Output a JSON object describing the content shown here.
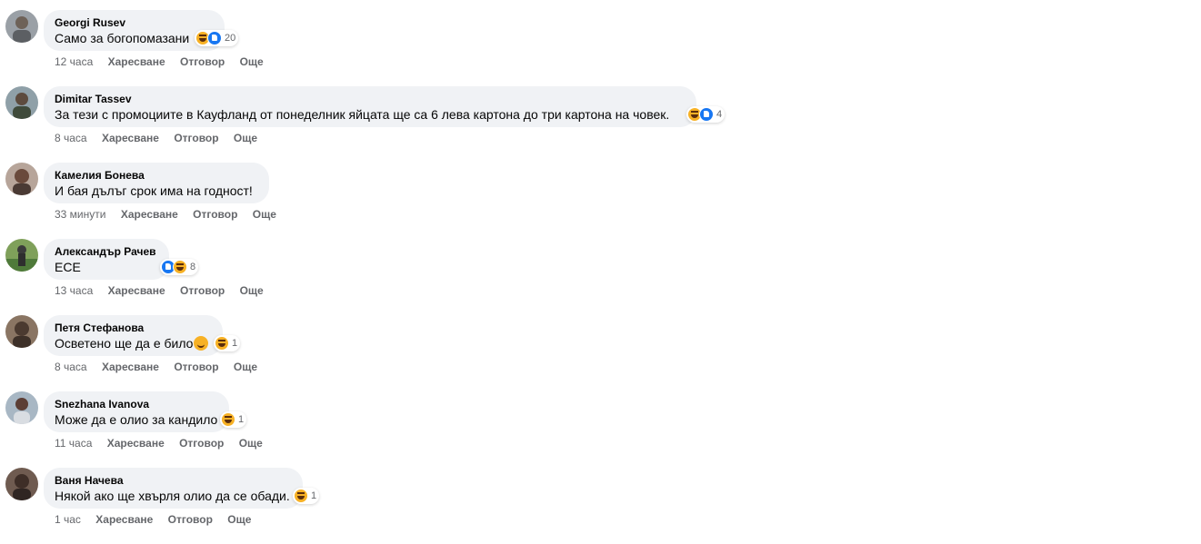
{
  "actions": {
    "like": "Харесване",
    "reply": "Отговор",
    "more": "Още"
  },
  "comments": [
    {
      "author": "Georgi Rusev",
      "text": "Само за богопомазани",
      "time": "12 часа",
      "reactions": [
        "laugh",
        "like"
      ],
      "count": "20",
      "avatar_color": "#7a7f86"
    },
    {
      "author": "Dimitar Tassev",
      "text": "За тези с промоциите в Кауфланд от понеделник яйцата ще са 6 лева картона до три картона на човек.",
      "time": "8 часа",
      "reactions": [
        "laugh",
        "like"
      ],
      "count": "4",
      "avatar_color": "#6b7a64"
    },
    {
      "author": "Камелия Бонева",
      "text": "И бая дълъг срок има на годност!",
      "time": "33 минути",
      "reactions": [],
      "count": "",
      "avatar_color": "#8a6f66"
    },
    {
      "author": "Александър Рачев",
      "text": "ЕСЕ",
      "time": "13 часа",
      "reactions": [
        "like",
        "laugh"
      ],
      "count": "8",
      "avatar_color": "#4f7a3a"
    },
    {
      "author": "Петя Стефанова",
      "text": "Осветено ще да е било",
      "time": "8 часа",
      "reactions": [
        "laugh"
      ],
      "count": "1",
      "avatar_color": "#6d5a4c"
    },
    {
      "author": "Snezhana Ivanova",
      "text": "Може да е олио за кандило",
      "time": "11 часа",
      "reactions": [
        "laugh"
      ],
      "count": "1",
      "avatar_color": "#7c8ea0"
    },
    {
      "author": "Ваня Начева",
      "text": "Някой ако ще хвърля олио да се обади.",
      "time": "1 час",
      "reactions": [
        "laugh"
      ],
      "count": "1",
      "avatar_color": "#5e4a40"
    }
  ]
}
